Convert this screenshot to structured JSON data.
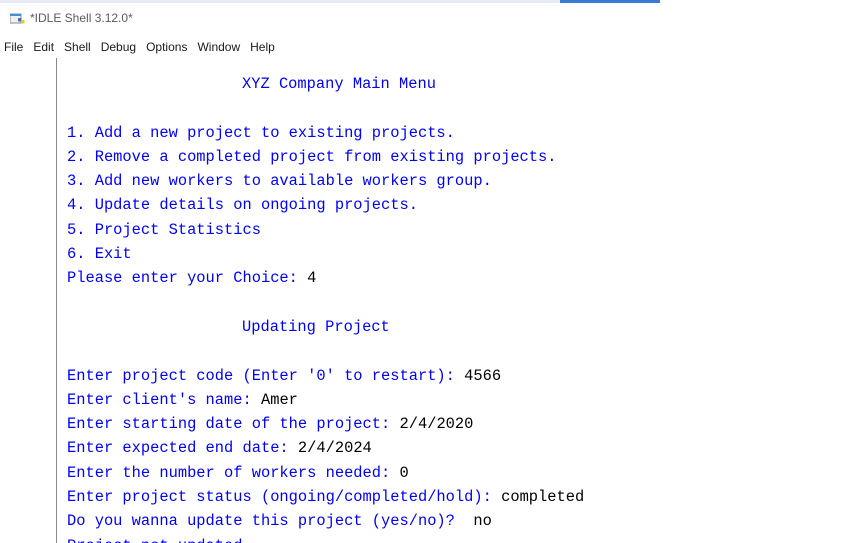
{
  "window": {
    "title": "*IDLE Shell 3.12.0*",
    "icon": "python-idle-icon"
  },
  "menubar": {
    "items": [
      "File",
      "Edit",
      "Shell",
      "Debug",
      "Options",
      "Window",
      "Help"
    ]
  },
  "shell": {
    "lines": [
      {
        "out": "XYZ Company Main Menu",
        "in": "",
        "kind": "heading"
      },
      {
        "out": "",
        "in": "",
        "kind": "blank"
      },
      {
        "out": "1. Add a new project to existing projects.",
        "in": ""
      },
      {
        "out": "2. Remove a completed project from existing projects.",
        "in": ""
      },
      {
        "out": "3. Add new workers to available workers group.",
        "in": ""
      },
      {
        "out": "4. Update details on ongoing projects.",
        "in": ""
      },
      {
        "out": "5. Project Statistics",
        "in": ""
      },
      {
        "out": "6. Exit",
        "in": ""
      },
      {
        "out": "Please enter your Choice: ",
        "in": "4"
      },
      {
        "out": "",
        "in": "",
        "kind": "blank"
      },
      {
        "out": "Updating Project",
        "in": "",
        "kind": "heading"
      },
      {
        "out": "",
        "in": "",
        "kind": "blank"
      },
      {
        "out": "Enter project code (Enter '0' to restart): ",
        "in": "4566"
      },
      {
        "out": "Enter client's name: ",
        "in": "Amer"
      },
      {
        "out": "Enter starting date of the project: ",
        "in": "2/4/2020"
      },
      {
        "out": "Enter expected end date: ",
        "in": "2/4/2024"
      },
      {
        "out": "Enter the number of workers needed: ",
        "in": "0"
      },
      {
        "out": "Enter project status (ongoing/completed/hold): ",
        "in": "completed"
      },
      {
        "out": "Do you wanna update this project (yes/no)? ",
        "in": " no"
      },
      {
        "out": "Project not updated.",
        "in": ""
      }
    ]
  },
  "colors": {
    "output_text": "#0000ff",
    "input_text": "#000000",
    "accent": "#3a7bd5"
  }
}
